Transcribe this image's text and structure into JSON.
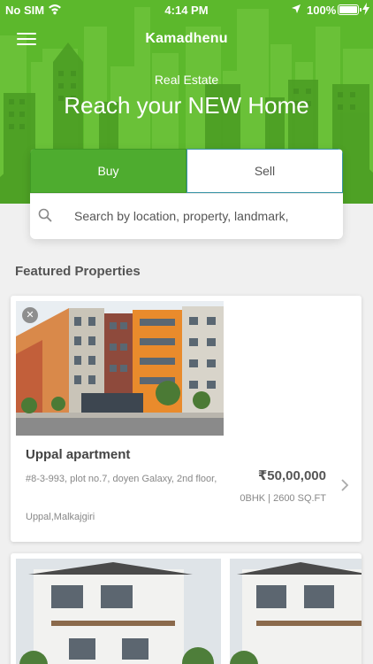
{
  "status_bar": {
    "carrier": "No SIM",
    "time": "4:14 PM",
    "battery": "100%"
  },
  "header": {
    "title": "Kamadhenu",
    "eyebrow": "Real Estate",
    "headline": "Reach your NEW Home"
  },
  "tabs": [
    {
      "label": "Buy",
      "active": true
    },
    {
      "label": "Sell",
      "active": false
    }
  ],
  "search": {
    "placeholder": "Search by location, property, landmark,"
  },
  "featured": {
    "title": "Featured Properties",
    "properties": [
      {
        "name": "Uppal apartment",
        "address": "#8-3-993, plot no.7, doyen Galaxy, 2nd floor,",
        "locality": "Uppal,Malkajgiri",
        "price": "₹50,00,000",
        "specs": "0BHK | 2600 SQ.FT"
      }
    ]
  },
  "colors": {
    "brand_green": "#5cb82c",
    "tab_active": "#4eac2f"
  },
  "icons": [
    "menu-icon",
    "wifi-icon",
    "location-arrow-icon",
    "battery-icon",
    "search-icon",
    "close-icon",
    "chevron-right-icon"
  ]
}
